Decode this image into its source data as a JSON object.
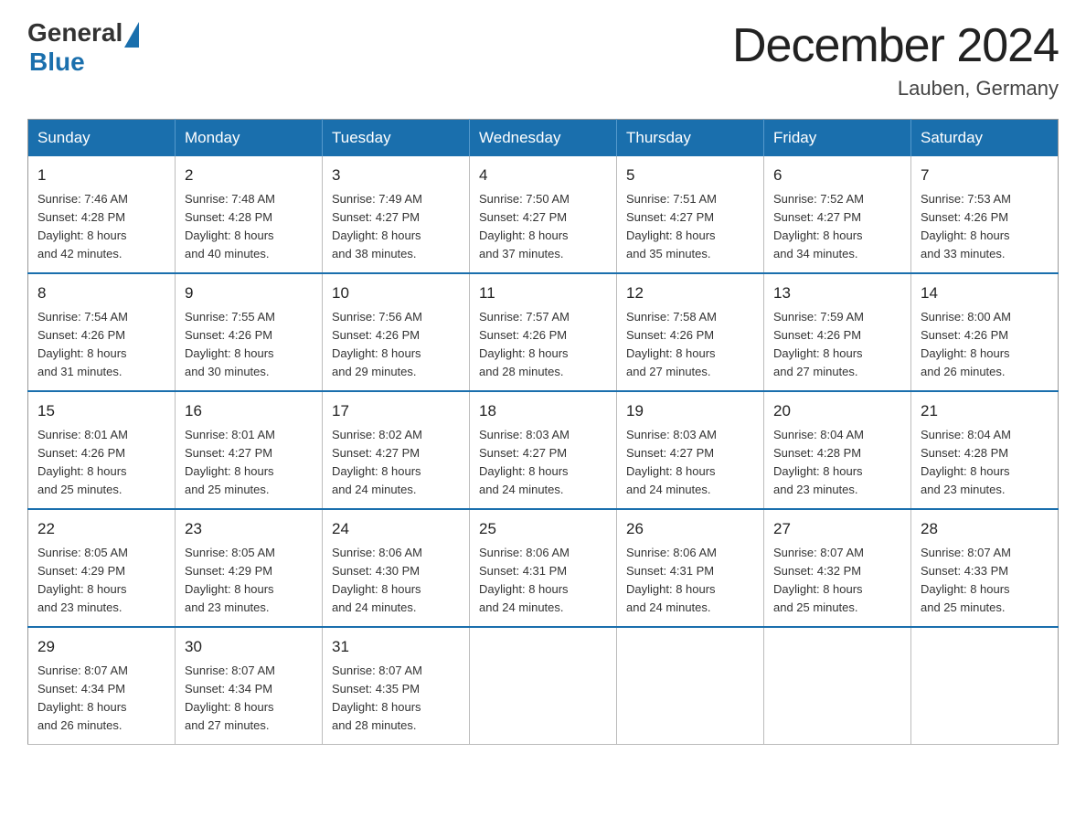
{
  "header": {
    "logo_general": "General",
    "logo_blue": "Blue",
    "title": "December 2024",
    "subtitle": "Lauben, Germany"
  },
  "weekdays": [
    "Sunday",
    "Monday",
    "Tuesday",
    "Wednesday",
    "Thursday",
    "Friday",
    "Saturday"
  ],
  "weeks": [
    [
      {
        "day": "1",
        "sunrise": "7:46 AM",
        "sunset": "4:28 PM",
        "daylight": "8 hours and 42 minutes."
      },
      {
        "day": "2",
        "sunrise": "7:48 AM",
        "sunset": "4:28 PM",
        "daylight": "8 hours and 40 minutes."
      },
      {
        "day": "3",
        "sunrise": "7:49 AM",
        "sunset": "4:27 PM",
        "daylight": "8 hours and 38 minutes."
      },
      {
        "day": "4",
        "sunrise": "7:50 AM",
        "sunset": "4:27 PM",
        "daylight": "8 hours and 37 minutes."
      },
      {
        "day": "5",
        "sunrise": "7:51 AM",
        "sunset": "4:27 PM",
        "daylight": "8 hours and 35 minutes."
      },
      {
        "day": "6",
        "sunrise": "7:52 AM",
        "sunset": "4:27 PM",
        "daylight": "8 hours and 34 minutes."
      },
      {
        "day": "7",
        "sunrise": "7:53 AM",
        "sunset": "4:26 PM",
        "daylight": "8 hours and 33 minutes."
      }
    ],
    [
      {
        "day": "8",
        "sunrise": "7:54 AM",
        "sunset": "4:26 PM",
        "daylight": "8 hours and 31 minutes."
      },
      {
        "day": "9",
        "sunrise": "7:55 AM",
        "sunset": "4:26 PM",
        "daylight": "8 hours and 30 minutes."
      },
      {
        "day": "10",
        "sunrise": "7:56 AM",
        "sunset": "4:26 PM",
        "daylight": "8 hours and 29 minutes."
      },
      {
        "day": "11",
        "sunrise": "7:57 AM",
        "sunset": "4:26 PM",
        "daylight": "8 hours and 28 minutes."
      },
      {
        "day": "12",
        "sunrise": "7:58 AM",
        "sunset": "4:26 PM",
        "daylight": "8 hours and 27 minutes."
      },
      {
        "day": "13",
        "sunrise": "7:59 AM",
        "sunset": "4:26 PM",
        "daylight": "8 hours and 27 minutes."
      },
      {
        "day": "14",
        "sunrise": "8:00 AM",
        "sunset": "4:26 PM",
        "daylight": "8 hours and 26 minutes."
      }
    ],
    [
      {
        "day": "15",
        "sunrise": "8:01 AM",
        "sunset": "4:26 PM",
        "daylight": "8 hours and 25 minutes."
      },
      {
        "day": "16",
        "sunrise": "8:01 AM",
        "sunset": "4:27 PM",
        "daylight": "8 hours and 25 minutes."
      },
      {
        "day": "17",
        "sunrise": "8:02 AM",
        "sunset": "4:27 PM",
        "daylight": "8 hours and 24 minutes."
      },
      {
        "day": "18",
        "sunrise": "8:03 AM",
        "sunset": "4:27 PM",
        "daylight": "8 hours and 24 minutes."
      },
      {
        "day": "19",
        "sunrise": "8:03 AM",
        "sunset": "4:27 PM",
        "daylight": "8 hours and 24 minutes."
      },
      {
        "day": "20",
        "sunrise": "8:04 AM",
        "sunset": "4:28 PM",
        "daylight": "8 hours and 23 minutes."
      },
      {
        "day": "21",
        "sunrise": "8:04 AM",
        "sunset": "4:28 PM",
        "daylight": "8 hours and 23 minutes."
      }
    ],
    [
      {
        "day": "22",
        "sunrise": "8:05 AM",
        "sunset": "4:29 PM",
        "daylight": "8 hours and 23 minutes."
      },
      {
        "day": "23",
        "sunrise": "8:05 AM",
        "sunset": "4:29 PM",
        "daylight": "8 hours and 23 minutes."
      },
      {
        "day": "24",
        "sunrise": "8:06 AM",
        "sunset": "4:30 PM",
        "daylight": "8 hours and 24 minutes."
      },
      {
        "day": "25",
        "sunrise": "8:06 AM",
        "sunset": "4:31 PM",
        "daylight": "8 hours and 24 minutes."
      },
      {
        "day": "26",
        "sunrise": "8:06 AM",
        "sunset": "4:31 PM",
        "daylight": "8 hours and 24 minutes."
      },
      {
        "day": "27",
        "sunrise": "8:07 AM",
        "sunset": "4:32 PM",
        "daylight": "8 hours and 25 minutes."
      },
      {
        "day": "28",
        "sunrise": "8:07 AM",
        "sunset": "4:33 PM",
        "daylight": "8 hours and 25 minutes."
      }
    ],
    [
      {
        "day": "29",
        "sunrise": "8:07 AM",
        "sunset": "4:34 PM",
        "daylight": "8 hours and 26 minutes."
      },
      {
        "day": "30",
        "sunrise": "8:07 AM",
        "sunset": "4:34 PM",
        "daylight": "8 hours and 27 minutes."
      },
      {
        "day": "31",
        "sunrise": "8:07 AM",
        "sunset": "4:35 PM",
        "daylight": "8 hours and 28 minutes."
      },
      null,
      null,
      null,
      null
    ]
  ],
  "labels": {
    "sunrise_prefix": "Sunrise: ",
    "sunset_prefix": "Sunset: ",
    "daylight_prefix": "Daylight: "
  }
}
